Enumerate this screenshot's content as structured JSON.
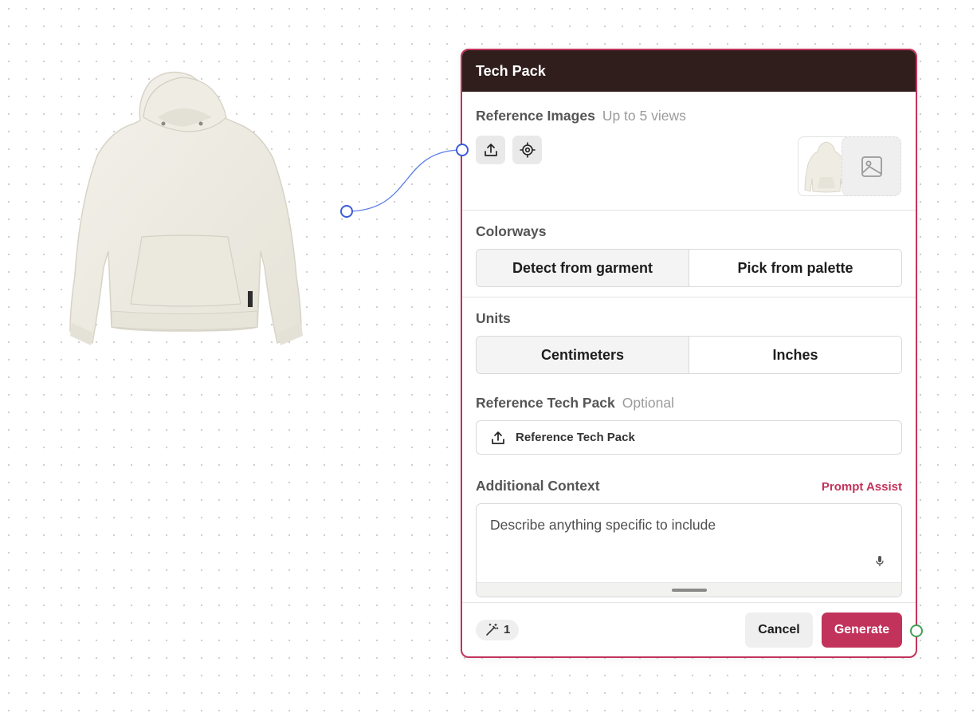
{
  "panel": {
    "title": "Tech Pack",
    "accent_color": "#c2335c",
    "header_color": "#2f1e1c"
  },
  "reference_images": {
    "label": "Reference Images",
    "hint": "Up to 5 views",
    "upload_icon": "upload-icon",
    "target_icon": "crosshair-icon",
    "add_icon": "image-icon"
  },
  "colorways": {
    "label": "Colorways",
    "options": [
      "Detect from garment",
      "Pick from palette"
    ],
    "selected": "Detect from garment"
  },
  "units": {
    "label": "Units",
    "options": [
      "Centimeters",
      "Inches"
    ],
    "selected": "Centimeters"
  },
  "reference_tech_pack": {
    "label": "Reference Tech Pack",
    "hint": "Optional",
    "button_label": "Reference Tech Pack"
  },
  "additional_context": {
    "label": "Additional Context",
    "prompt_assist": "Prompt Assist",
    "placeholder": "Describe anything specific to include",
    "value": ""
  },
  "footer": {
    "credits": "1",
    "cancel_label": "Cancel",
    "generate_label": "Generate"
  }
}
